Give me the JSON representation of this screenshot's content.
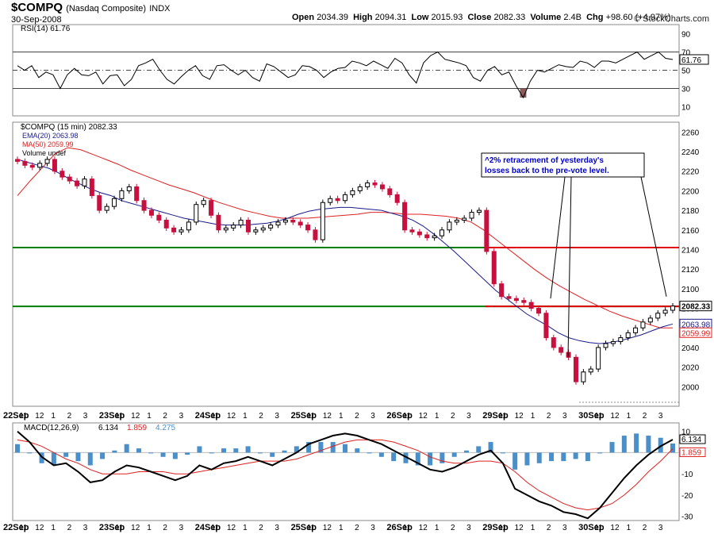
{
  "header": {
    "symbol": "$COMPQ",
    "description": "(Nasdaq Composite)",
    "exchange": "INDX",
    "date": "30-Sep-2008",
    "open_label": "Open",
    "open": "2034.39",
    "high_label": "High",
    "high": "2094.31",
    "low_label": "Low",
    "low": "2015.93",
    "close_label": "Close",
    "close": "2082.33",
    "volume_label": "Volume",
    "volume": "2.4B",
    "chg_label": "Chg",
    "chg": "+98.60 (+4.97%)",
    "credit": "© StockCharts.com",
    "credit_icon": "stockcharts-logo-icon"
  },
  "colors": {
    "up_candle": "#000000",
    "down_candle": "#c8103e",
    "ema": "#1a1a8c",
    "ma": "#e02020",
    "support": "#008000",
    "resistance": "#e00000",
    "rsi_fill": "#8b5a5a",
    "histogram": "#4b8fc8",
    "macd": "#000000",
    "signal": "#e02020",
    "annotation": "#0000cc"
  },
  "chart_data": [
    {
      "type": "line",
      "panel": "RSI",
      "legend": "RSI(14) 61.76",
      "ylim": [
        0,
        100
      ],
      "yticks": [
        10,
        30,
        50,
        70,
        90
      ],
      "reference_lines": [
        30,
        50,
        70
      ],
      "last_value": "61.76",
      "series": [
        {
          "values": [
            55,
            50,
            55,
            42,
            48,
            45,
            30,
            45,
            52,
            45,
            44,
            48,
            35,
            44,
            45,
            33,
            40,
            55,
            58,
            62,
            50,
            40,
            35,
            43,
            50,
            55,
            44,
            40,
            55,
            56,
            50,
            45,
            50,
            42,
            38,
            57,
            54,
            48,
            42,
            45,
            55,
            54,
            50,
            42,
            48,
            52,
            53,
            60,
            58,
            55,
            60,
            56,
            52,
            63,
            58,
            45,
            36,
            58,
            66,
            70,
            62,
            60,
            58,
            55,
            42,
            38,
            50,
            54,
            45,
            48,
            33,
            20,
            38,
            50,
            48,
            52,
            56,
            54,
            53,
            60,
            58,
            53,
            60,
            60,
            58,
            62,
            66,
            70,
            62,
            66,
            70,
            63,
            61.76
          ]
        }
      ]
    },
    {
      "type": "candlestick",
      "panel": "price",
      "legend": [
        "$COMPQ (15 min) 2082.33",
        "EMA(20) 2063.98",
        "MA(50) 2059.99",
        "Volume undef"
      ],
      "ylim": [
        1980,
        2270
      ],
      "yticks": [
        2000,
        2020,
        2040,
        2060,
        2080,
        2100,
        2120,
        2140,
        2160,
        2180,
        2200,
        2220,
        2240,
        2260
      ],
      "x_tick_labels": [
        "22Sep",
        "11",
        "12",
        "1",
        "2",
        "3",
        "23Sep",
        "11",
        "12",
        "1",
        "2",
        "3",
        "24Sep",
        "11",
        "12",
        "1",
        "2",
        "3",
        "25Sep",
        "11",
        "12",
        "1",
        "2",
        "3",
        "26Sep",
        "11",
        "12",
        "1",
        "2",
        "3",
        "29Sep",
        "11",
        "12",
        "1",
        "2",
        "3",
        "30Sep",
        "11",
        "12",
        "1",
        "2",
        "3"
      ],
      "horizontal_lines": [
        {
          "value": 2142,
          "color": "#e00000"
        },
        {
          "value": 2142,
          "color": "#008000",
          "extent": "left"
        },
        {
          "value": 2082,
          "color": "#e00000"
        },
        {
          "value": 2082,
          "color": "#008000",
          "extent": "left"
        }
      ],
      "low_dotted_line": 1984,
      "price_labels": [
        "2082.33",
        "2063.98",
        "2059.99"
      ],
      "annotation": "^2% retracement of yesterday's losses back to the pre-vote level.",
      "close": [
        2230,
        2226,
        2224,
        2228,
        2232,
        2220,
        2214,
        2210,
        2205,
        2212,
        2195,
        2180,
        2184,
        2192,
        2200,
        2204,
        2190,
        2180,
        2175,
        2170,
        2162,
        2158,
        2160,
        2168,
        2186,
        2190,
        2175,
        2160,
        2162,
        2165,
        2170,
        2158,
        2160,
        2162,
        2165,
        2168,
        2170,
        2168,
        2165,
        2160,
        2150,
        2188,
        2192,
        2190,
        2196,
        2200,
        2204,
        2208,
        2206,
        2202,
        2196,
        2188,
        2160,
        2158,
        2155,
        2152,
        2154,
        2160,
        2168,
        2170,
        2172,
        2178,
        2180,
        2138,
        2105,
        2092,
        2090,
        2088,
        2086,
        2080,
        2075,
        2050,
        2040,
        2035,
        2030,
        2005,
        2015,
        2018,
        2040,
        2044,
        2046,
        2050,
        2055,
        2060,
        2066,
        2070,
        2075,
        2078,
        2082.33
      ],
      "ema20": [
        2232,
        2229,
        2226,
        2223,
        2218,
        2212,
        2207,
        2202,
        2198,
        2195,
        2190,
        2187,
        2184,
        2181,
        2178,
        2175,
        2172,
        2170,
        2168,
        2166,
        2165,
        2165,
        2165,
        2166,
        2167,
        2169,
        2172,
        2176,
        2179,
        2181,
        2182,
        2183,
        2183,
        2182,
        2181,
        2180,
        2177,
        2174,
        2170,
        2164,
        2156,
        2147,
        2138,
        2128,
        2118,
        2108,
        2098,
        2090,
        2082,
        2074,
        2068,
        2062,
        2055,
        2050,
        2047,
        2045,
        2044,
        2045,
        2047,
        2050,
        2053,
        2057,
        2061,
        2063.98
      ],
      "ma50": [
        2195,
        2210,
        2224,
        2238,
        2244,
        2242,
        2237,
        2232,
        2227,
        2221,
        2216,
        2211,
        2206,
        2202,
        2198,
        2193,
        2188,
        2184,
        2180,
        2177,
        2174,
        2172,
        2172,
        2172,
        2173,
        2174,
        2175,
        2176,
        2178,
        2178,
        2177,
        2176,
        2176,
        2175,
        2174,
        2172,
        2168,
        2160,
        2150,
        2140,
        2130,
        2120,
        2111,
        2103,
        2096,
        2089,
        2083,
        2077,
        2072,
        2068,
        2064,
        2060,
        2059.99
      ]
    },
    {
      "type": "line",
      "panel": "MACD",
      "legend": {
        "title": "MACD(12,26,9)",
        "macd": "6.134",
        "signal": "1.859",
        "histogram": "4.275"
      },
      "ylim": [
        -32,
        14
      ],
      "yticks": [
        -30,
        -20,
        -10,
        0,
        10
      ],
      "last_labels": [
        "6.134",
        "1.859"
      ],
      "x_tick_labels": [
        "22Sep",
        "11",
        "12",
        "1",
        "2",
        "3",
        "23Sep",
        "11",
        "12",
        "1",
        "2",
        "3",
        "24Sep",
        "11",
        "12",
        "1",
        "2",
        "3",
        "25Sep",
        "11",
        "12",
        "1",
        "2",
        "3",
        "26Sep",
        "11",
        "12",
        "1",
        "2",
        "3",
        "29Sep",
        "11",
        "12",
        "1",
        "2",
        "3",
        "30Sep",
        "11",
        "12",
        "1",
        "2",
        "3"
      ],
      "series": [
        {
          "name": "MACD",
          "values": [
            10,
            5,
            -2,
            -6,
            -5,
            -9,
            -14,
            -13,
            -9,
            -6,
            -7,
            -9,
            -11,
            -13,
            -11,
            -6,
            -8,
            -5,
            -4,
            -2,
            -4,
            -6,
            -3,
            0,
            4,
            6,
            8,
            9,
            8,
            6,
            4,
            1,
            -2,
            -5,
            -8,
            -9,
            -7,
            -4,
            -1,
            1,
            -5,
            -17,
            -20,
            -23,
            -25,
            -28,
            -29,
            -31,
            -26,
            -19,
            -12,
            -6,
            -1,
            3,
            6.134
          ]
        },
        {
          "name": "Signal",
          "values": [
            6,
            5,
            3,
            0,
            -3,
            -5,
            -8,
            -10,
            -10,
            -10,
            -9,
            -9,
            -9,
            -10,
            -10,
            -9,
            -8,
            -7,
            -6,
            -5,
            -4,
            -4,
            -4,
            -3,
            -1,
            1,
            3,
            5,
            6,
            6,
            6,
            5,
            3,
            1,
            -2,
            -4,
            -5,
            -5,
            -4,
            -4,
            -5,
            -9,
            -14,
            -18,
            -21,
            -24,
            -26,
            -27,
            -26,
            -24,
            -20,
            -15,
            -9,
            -4,
            1.859
          ]
        },
        {
          "name": "Histogram",
          "values": [
            4,
            0,
            -5,
            -6,
            -2,
            -4,
            -6,
            -3,
            1,
            4,
            2,
            0,
            -2,
            -3,
            -1,
            3,
            0,
            2,
            2,
            3,
            0,
            -2,
            1,
            3,
            5,
            5,
            5,
            4,
            2,
            0,
            -2,
            -4,
            -5,
            -6,
            -6,
            -5,
            -2,
            1,
            3,
            5,
            0,
            -8,
            -6,
            -5,
            -4,
            -4,
            -3,
            -4,
            0,
            5,
            8,
            9,
            8,
            7,
            4.275
          ]
        }
      ]
    }
  ]
}
